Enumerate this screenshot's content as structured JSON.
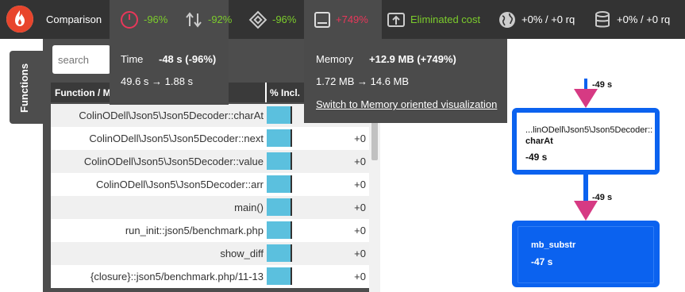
{
  "header": {
    "comparison_label": "Comparison",
    "metrics": {
      "time": "-96%",
      "io": "-92%",
      "cpu": "-96%",
      "memory": "+749%",
      "cost": "Eliminated cost",
      "network": "+0% / +0 rq",
      "sql": "+0% / +0 rq"
    }
  },
  "sidebar": {
    "tab_label": "Functions",
    "search_placeholder": "search"
  },
  "table": {
    "columns": [
      "Function / M",
      "% Incl."
    ],
    "rows": [
      {
        "function": "ColinODell\\Json5\\Json5Decoder::charAt",
        "incl": ""
      },
      {
        "function": "ColinODell\\Json5\\Json5Decoder::next",
        "incl": "+0"
      },
      {
        "function": "ColinODell\\Json5\\Json5Decoder::value",
        "incl": "+0"
      },
      {
        "function": "ColinODell\\Json5\\Json5Decoder::arr",
        "incl": "+0"
      },
      {
        "function": "main()",
        "incl": "+0"
      },
      {
        "function": "run_init::json5/benchmark.php",
        "incl": "+0"
      },
      {
        "function": "show_diff",
        "incl": "+0"
      },
      {
        "function": "{closure}::json5/benchmark.php/11-13",
        "incl": "+0"
      }
    ]
  },
  "tooltips": {
    "time": {
      "label": "Time",
      "value": "-48 s (-96%)",
      "range": "49.6 s → 1.88 s"
    },
    "memory": {
      "label": "Memory",
      "value": "+12.9 MB (+749%)",
      "range": "1.72 MB → 14.6 MB",
      "link": "Switch to Memory oriented visualization"
    }
  },
  "graph": {
    "edge_top_label": "-49 s",
    "edge_mid_label": "-49 s",
    "node1": {
      "namespace": "...linODell\\Json5\\Json5Decoder::",
      "name": "charAt",
      "value": "-49 s"
    },
    "node2": {
      "name": "mb_substr",
      "value": "-47 s"
    }
  },
  "colors": {
    "positive": "#7ccc2c",
    "negative": "#e8375a",
    "node_blue": "#0b62ef",
    "edge_pink": "#d63a83",
    "bar_blue": "#5bc0de"
  }
}
